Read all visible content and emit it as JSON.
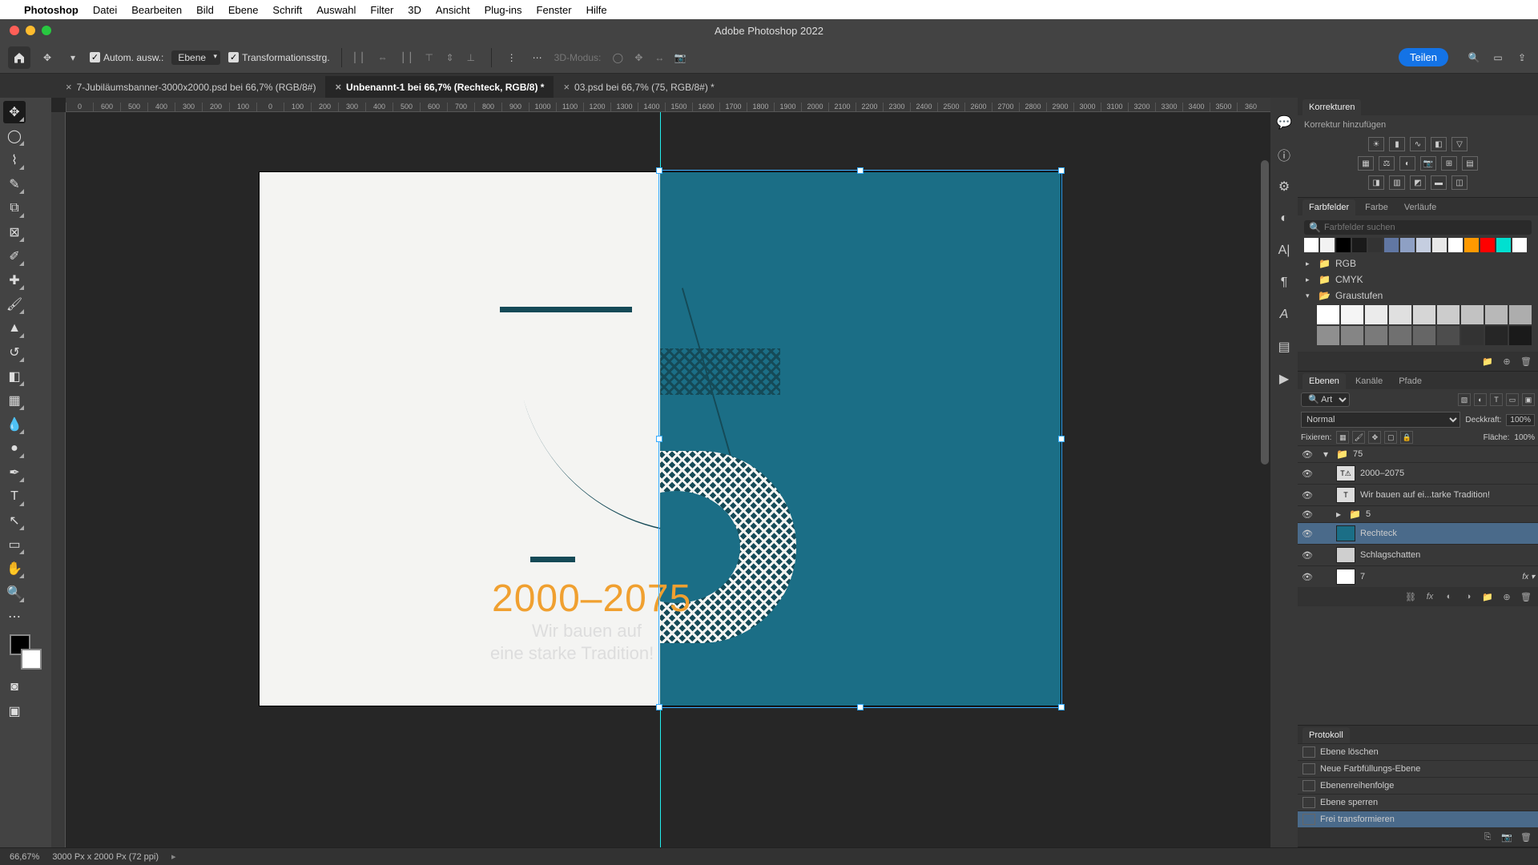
{
  "menubar": [
    "Photoshop",
    "Datei",
    "Bearbeiten",
    "Bild",
    "Ebene",
    "Schrift",
    "Auswahl",
    "Filter",
    "3D",
    "Ansicht",
    "Plug-ins",
    "Fenster",
    "Hilfe"
  ],
  "window_title": "Adobe Photoshop 2022",
  "options": {
    "auto_select": "Autom. ausw.:",
    "target": "Ebene",
    "transform": "Transformationsstrg.",
    "mode_3d": "3D-Modus:",
    "share": "Teilen"
  },
  "tabs": [
    {
      "label": "7-Jubiläumsbanner-3000x2000.psd bei 66,7% (RGB/8#)",
      "active": false
    },
    {
      "label": "Unbenannt-1 bei 66,7% (Rechteck, RGB/8) *",
      "active": true
    },
    {
      "label": "03.psd bei 66,7% (75, RGB/8#) *",
      "active": false
    }
  ],
  "ruler_ticks": [
    "0",
    "600",
    "500",
    "400",
    "300",
    "200",
    "100",
    "0",
    "100",
    "200",
    "300",
    "400",
    "500",
    "600",
    "700",
    "800",
    "900",
    "1000",
    "1100",
    "1200",
    "1300",
    "1400",
    "1500",
    "1600",
    "1700",
    "1800",
    "1900",
    "2000",
    "2100",
    "2200",
    "2300",
    "2400",
    "2500",
    "2600",
    "2700",
    "2800",
    "2900",
    "3000",
    "3100",
    "3200",
    "3300",
    "3400",
    "3500",
    "360"
  ],
  "canvas": {
    "year_text": "2000–2075",
    "sub1": "Wir bauen auf",
    "sub2": "eine starke Tradition!"
  },
  "panels": {
    "korrekturen": {
      "title": "Korrekturen",
      "add": "Korrektur hinzufügen"
    },
    "swatches": {
      "tabs": [
        "Farbfelder",
        "Farbe",
        "Verläufe"
      ],
      "search_ph": "Farbfelder suchen",
      "colors_top": [
        "#ffffff",
        "#f2f2f2",
        "#000000",
        "#1a1a1a",
        "#333333",
        "#6177a3",
        "#8ea0c4",
        "#c5cee0",
        "#e8e8e8",
        "#ffffff",
        "#ff9900",
        "#ff0000",
        "#00e0d0",
        "#ffffff"
      ],
      "folders": [
        {
          "name": "RGB",
          "open": false
        },
        {
          "name": "CMYK",
          "open": false
        },
        {
          "name": "Graustufen",
          "open": true
        }
      ],
      "grays": [
        "#ffffff",
        "#f5f5f5",
        "#ebebeb",
        "#e0e0e0",
        "#d6d6d6",
        "#cccccc",
        "#c2c2c2",
        "#b8b8b8",
        "#adadad",
        "#8f8f8f",
        "#858585",
        "#7a7a7a",
        "#707070",
        "#666666",
        "#4d4d4d",
        "#333333",
        "#262626",
        "#1a1a1a"
      ]
    },
    "layers": {
      "tabs": [
        "Ebenen",
        "Kanäle",
        "Pfade"
      ],
      "filter": "Art",
      "blend": "Normal",
      "opacity_label": "Deckkraft:",
      "opacity": "100%",
      "lock_label": "Fixieren:",
      "fill_label": "Fläche:",
      "fill": "100%",
      "items": [
        {
          "name": "75",
          "type": "group",
          "indent": 0,
          "eye": true,
          "open": true
        },
        {
          "name": "2000–2075",
          "type": "text",
          "indent": 1,
          "eye": true,
          "warn": true
        },
        {
          "name": "Wir bauen auf ei...tarke Tradition!",
          "type": "text",
          "indent": 1,
          "eye": true
        },
        {
          "name": "5",
          "type": "group",
          "indent": 1,
          "eye": true
        },
        {
          "name": "Rechteck",
          "type": "shape",
          "indent": 1,
          "eye": true,
          "selected": true,
          "thumb": "#1b6e86"
        },
        {
          "name": "Schlagschatten",
          "type": "shape",
          "indent": 1,
          "eye": true,
          "thumb": "#cfcfcf"
        },
        {
          "name": "7",
          "type": "shape",
          "indent": 1,
          "eye": true,
          "thumb": "#ffffff",
          "fx": true
        }
      ]
    },
    "history": {
      "title": "Protokoll",
      "items": [
        "Ebene löschen",
        "Neue Farbfüllungs-Ebene",
        "Ebenenreihenfolge",
        "Ebene sperren",
        "Frei transformieren"
      ],
      "selected_index": 4
    }
  },
  "status": {
    "zoom": "66,67%",
    "dims": "3000 Px x 2000 Px (72 ppi)"
  }
}
